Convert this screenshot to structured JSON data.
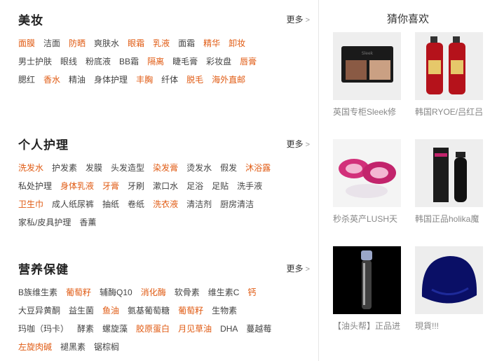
{
  "sections": [
    {
      "title": "美妆",
      "more": "更多",
      "rows": [
        [
          {
            "t": "面膜",
            "h": true
          },
          {
            "t": "洁面",
            "h": false
          },
          {
            "t": "防晒",
            "h": true
          },
          {
            "t": "爽肤水",
            "h": false
          },
          {
            "t": "眼霜",
            "h": true
          },
          {
            "t": "乳液",
            "h": true
          },
          {
            "t": "面霜",
            "h": false
          },
          {
            "t": "精华",
            "h": true
          },
          {
            "t": "卸妆",
            "h": true
          }
        ],
        [
          {
            "t": "男士护肤",
            "h": false
          },
          {
            "t": "眼线",
            "h": false
          },
          {
            "t": "粉底液",
            "h": false
          },
          {
            "t": "BB霜",
            "h": false
          },
          {
            "t": "隔离",
            "h": true
          },
          {
            "t": "睫毛膏",
            "h": false
          },
          {
            "t": "彩妆盘",
            "h": false
          },
          {
            "t": "唇膏",
            "h": true
          }
        ],
        [
          {
            "t": "腮红",
            "h": false
          },
          {
            "t": "香水",
            "h": true
          },
          {
            "t": "精油",
            "h": false
          },
          {
            "t": "身体护理",
            "h": false
          },
          {
            "t": "丰胸",
            "h": true
          },
          {
            "t": "纤体",
            "h": false
          },
          {
            "t": "脱毛",
            "h": true
          },
          {
            "t": "海外直邮",
            "h": true
          }
        ]
      ]
    },
    {
      "title": "个人护理",
      "more": "更多",
      "rows": [
        [
          {
            "t": "洗发水",
            "h": true
          },
          {
            "t": "护发素",
            "h": false
          },
          {
            "t": "发膜",
            "h": false
          },
          {
            "t": "头发造型",
            "h": false
          },
          {
            "t": "染发膏",
            "h": true
          },
          {
            "t": "烫发水",
            "h": false
          },
          {
            "t": "假发",
            "h": false
          },
          {
            "t": "沐浴露",
            "h": true
          }
        ],
        [
          {
            "t": "私处护理",
            "h": false
          },
          {
            "t": "身体乳液",
            "h": true
          },
          {
            "t": "牙膏",
            "h": true
          },
          {
            "t": "牙刷",
            "h": false
          },
          {
            "t": "漱口水",
            "h": false
          },
          {
            "t": "足浴",
            "h": false
          },
          {
            "t": "足贴",
            "h": false
          },
          {
            "t": "洗手液",
            "h": false
          }
        ],
        [
          {
            "t": "卫生巾",
            "h": true
          },
          {
            "t": "成人纸尿裤",
            "h": false
          },
          {
            "t": "抽纸",
            "h": false
          },
          {
            "t": "卷纸",
            "h": false
          },
          {
            "t": "洗衣液",
            "h": true
          },
          {
            "t": "清洁剂",
            "h": false
          },
          {
            "t": "厨房清洁",
            "h": false
          }
        ],
        [
          {
            "t": "家私/皮具护理",
            "h": false
          },
          {
            "t": "香薰",
            "h": false
          }
        ]
      ]
    },
    {
      "title": "营养保健",
      "more": "更多",
      "rows": [
        [
          {
            "t": "B族维生素",
            "h": false
          },
          {
            "t": "葡萄籽",
            "h": true
          },
          {
            "t": "辅酶Q10",
            "h": false
          },
          {
            "t": "消化酶",
            "h": true
          },
          {
            "t": "软骨素",
            "h": false
          },
          {
            "t": "维生素C",
            "h": false
          },
          {
            "t": "钙",
            "h": true
          }
        ],
        [
          {
            "t": "大豆异黄酮",
            "h": false
          },
          {
            "t": "益生菌",
            "h": false
          },
          {
            "t": "鱼油",
            "h": true
          },
          {
            "t": "氨基葡萄糖",
            "h": false
          },
          {
            "t": "葡萄籽",
            "h": true
          },
          {
            "t": "生物素",
            "h": false
          }
        ],
        [
          {
            "t": "玛咖（玛卡）",
            "h": false
          },
          {
            "t": "酵素",
            "h": false
          },
          {
            "t": "螺旋藻",
            "h": false
          },
          {
            "t": "胶原蛋白",
            "h": true
          },
          {
            "t": "月见草油",
            "h": true
          },
          {
            "t": "DHA",
            "h": false
          },
          {
            "t": "蔓越莓",
            "h": false
          }
        ],
        [
          {
            "t": "左旋肉碱",
            "h": true
          },
          {
            "t": "褪黑素",
            "h": false
          },
          {
            "t": "锯棕榈",
            "h": false
          }
        ]
      ]
    }
  ],
  "recommend": {
    "title": "猜你喜欢",
    "items": [
      {
        "caption": "英国专柜Sleek修",
        "icon": "contour-palette-image"
      },
      {
        "caption": "韩国RYOE/吕红吕",
        "icon": "red-shampoo-bottles-image"
      },
      {
        "caption": "秒杀英产LUSH天",
        "icon": "pink-swirl-soap-image"
      },
      {
        "caption": "韩国正品holika魔",
        "icon": "black-serum-bottle-image"
      },
      {
        "caption": "【油头帮】正品进",
        "icon": "clear-vial-image"
      },
      {
        "caption": "現貨!!!",
        "icon": "navy-wig-cap-image"
      }
    ]
  },
  "colors": {
    "highlight": "#e05a12",
    "text": "#444444",
    "caption": "#888888",
    "divider": "#e6e6e6"
  }
}
